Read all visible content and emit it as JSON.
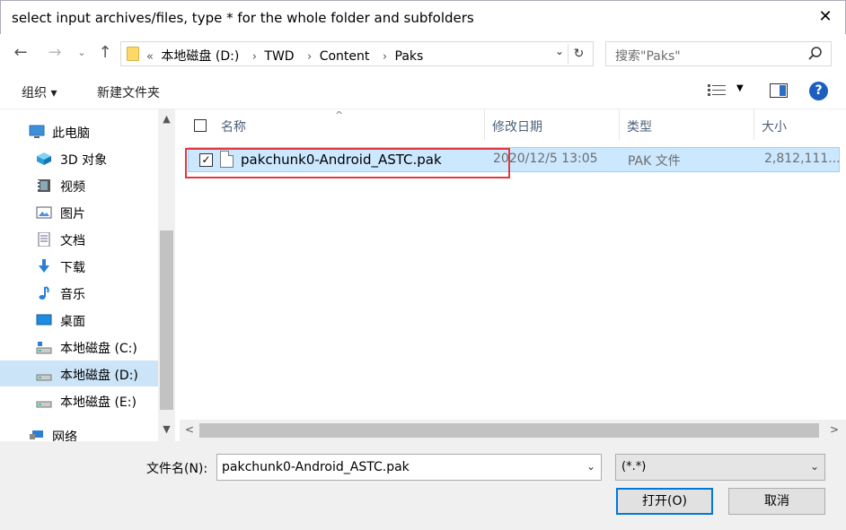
{
  "window": {
    "title": "select input archives/files, type * for the whole folder and subfolders",
    "close_symbol": "✕"
  },
  "address": {
    "prefix": "«",
    "crumbs": [
      "本地磁盘 (D:)",
      "TWD",
      "Content",
      "Paks"
    ],
    "separator": "›",
    "search_placeholder": "搜索\"Paks\""
  },
  "toolbar": {
    "organize_label": "组织 ▾",
    "new_folder_label": "新建文件夹",
    "help_symbol": "?"
  },
  "navigation": {
    "items": [
      {
        "label": "此电脑",
        "icon": "computer-icon"
      },
      {
        "label": "3D 对象",
        "icon": "3d-objects-icon"
      },
      {
        "label": "视频",
        "icon": "videos-icon"
      },
      {
        "label": "图片",
        "icon": "pictures-icon"
      },
      {
        "label": "文档",
        "icon": "documents-icon"
      },
      {
        "label": "下载",
        "icon": "downloads-icon"
      },
      {
        "label": "音乐",
        "icon": "music-icon"
      },
      {
        "label": "桌面",
        "icon": "desktop-icon"
      },
      {
        "label": "本地磁盘 (C:)",
        "icon": "drive-icon"
      },
      {
        "label": "本地磁盘 (D:)",
        "icon": "drive-icon",
        "selected": true
      },
      {
        "label": "本地磁盘 (E:)",
        "icon": "drive-icon"
      },
      {
        "label": "网络",
        "icon": "network-icon"
      }
    ]
  },
  "columns": {
    "name": "名称",
    "modified": "修改日期",
    "type": "类型",
    "size": "大小"
  },
  "files": [
    {
      "name": "pakchunk0-Android_ASTC.pak",
      "modified": "2020/12/5 13:05",
      "type": "PAK 文件",
      "size": "2,812,111...",
      "checked": true,
      "check_symbol": "✓"
    }
  ],
  "footer": {
    "filename_label": "文件名(N):",
    "filename_value": "pakchunk0-Android_ASTC.pak",
    "filetype_value": "(*.*)",
    "open_button": "打开(O)",
    "cancel_button": "取消"
  },
  "colors": {
    "selection_bg": "#cce8ff",
    "highlight_border": "#e0393e",
    "accent": "#0078d7"
  }
}
